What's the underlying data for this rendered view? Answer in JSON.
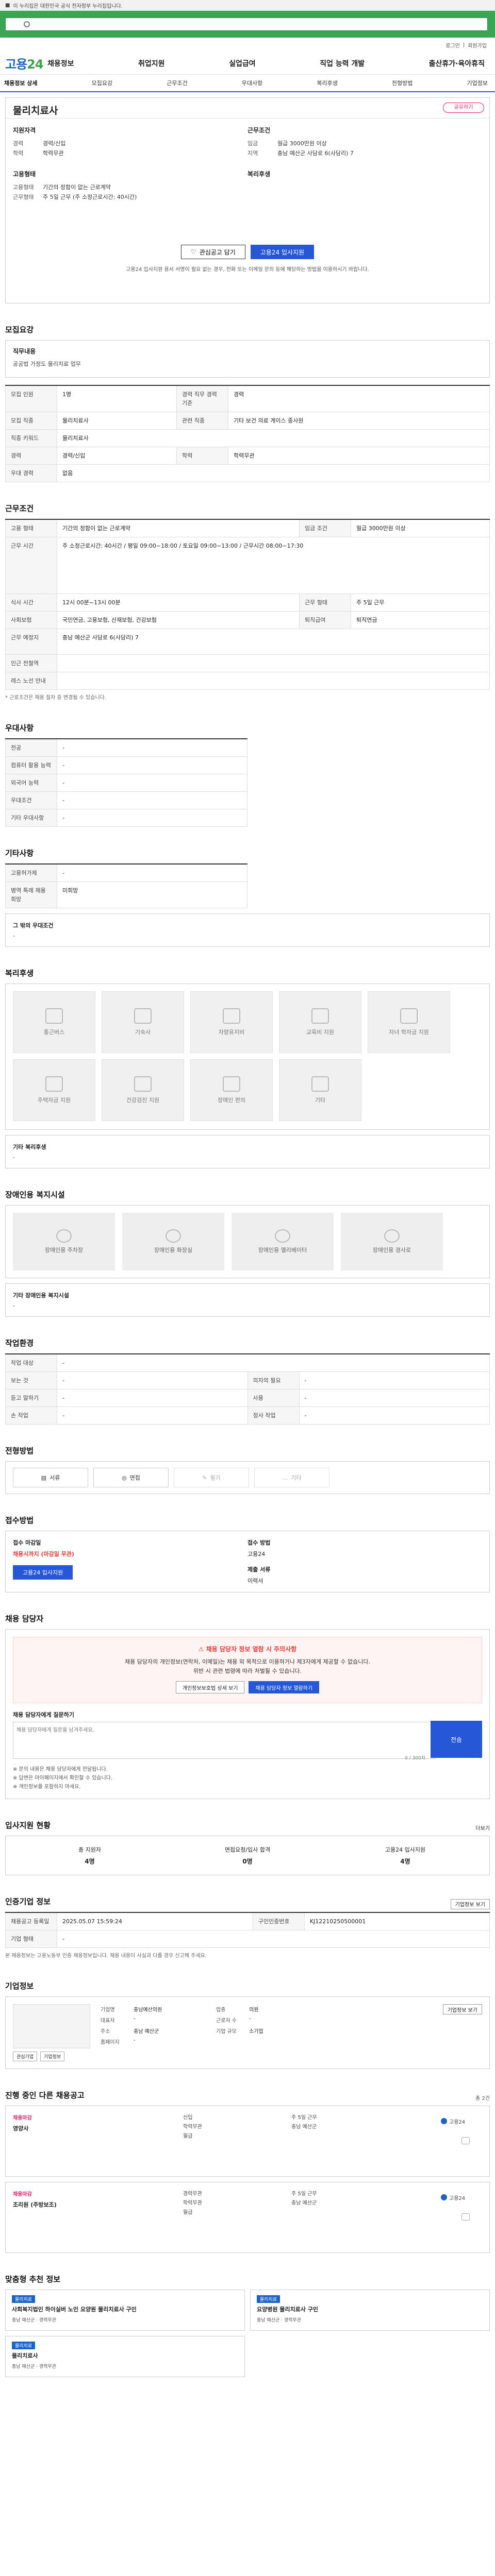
{
  "gov": {
    "text": "이 누리집은 대한민국 공식 전자정부 누리집입니다."
  },
  "search": {
    "placeholder": ""
  },
  "loginbar": {
    "login": "로그인",
    "join": "회원가입"
  },
  "gnb": {
    "logo_a": "고용",
    "logo_b": "24",
    "menu": [
      "채용정보",
      "취업지원",
      "실업급여",
      "직업 능력 개발",
      "출산휴가·육아휴직"
    ]
  },
  "snb": {
    "items": [
      "채용정보 상세",
      "모집요강",
      "근무조건",
      "우대사항",
      "복리후생",
      "전형방법",
      "기업정보"
    ]
  },
  "head": {
    "title": "물리치료사",
    "share": "공유하기",
    "col1": {
      "g1": {
        "title": "지원자격",
        "rows": [
          {
            "k": "경력",
            "v": "경력/신입"
          },
          {
            "k": "학력",
            "v": "학력무관"
          }
        ]
      },
      "g2": {
        "title": "고용형태",
        "rows": [
          {
            "k": "고용형태",
            "v": "기간의 정함이 없는 근로계약"
          },
          {
            "k": "근무형태",
            "v": "주 5일 근무 (주 소정근로시간: 40시간)"
          }
        ]
      }
    },
    "col2": {
      "g1": {
        "title": "근무조건",
        "rows": [
          {
            "k": "임금",
            "v": "월급 3000만원 이상"
          },
          {
            "k": "지역",
            "v": "충남 예산군 사담로 6(사담리) 7"
          }
        ]
      },
      "g2": {
        "title": "복리후생",
        "rows": []
      }
    },
    "btn_save": "관심공고 담기",
    "btn_apply": "고용24 입사지원",
    "note": "고용24 입사지원 용서 서명이 필요 없는 경우, 전화 또는 이메일 문의 등에 해당하는 방법을 이용하시기 바랍니다."
  },
  "recruit": {
    "h": "모집요강",
    "box_title": "직무내용",
    "box_text": "공공법 가정도 물리치료 업무"
  },
  "req": {
    "rows": [
      {
        "k": "모집 인원",
        "v": "1명",
        "k2": "경력 직무 경력 기준",
        "v2": "경력"
      },
      {
        "k": "모집 직종",
        "v": "물리치료사",
        "k2": "관련 직종",
        "v2": "기타 보건 의료 게이스 종사원"
      },
      {
        "k": "직종 키워드",
        "v": "물리치료사",
        "k2": "",
        "v2": ""
      },
      {
        "k": "경력",
        "v": "경력/신입",
        "k2": "학력",
        "v2": "학력무관"
      },
      {
        "k": "우대 경력",
        "v": "없음",
        "k2": "",
        "v2": ""
      }
    ]
  },
  "cond": {
    "h": "근무조건",
    "rows": [
      {
        "k": "고용 형태",
        "v": "기간의 정함이 없는 근로계약",
        "k2": "임금 조건",
        "v2": "월급 3000만원 이상"
      },
      {
        "k": "근무 시간",
        "v": "주 소정근로시간: 40시간 / 평일 09:00~18:00 / 토요일 09:00~13:00 / 근무시간 08:00~17:30",
        "k2": "",
        "v2": ""
      },
      {
        "k": "식사 시간",
        "v": "12시 00분~13시 00분",
        "k2": "근무 형태",
        "v2": "주 5일 근무"
      },
      {
        "k": "사회보험",
        "v": "국민연금, 고용보험, 산재보험, 건강보험",
        "k2": "퇴직급여",
        "v2": "퇴직연금"
      },
      {
        "k": "근무 예정지",
        "v": "충남 예산군 사담로 6(사담리) 7",
        "k2": "",
        "v2": ""
      },
      {
        "k": "인근 전철역",
        "v": "",
        "k2": "",
        "v2": ""
      },
      {
        "k": "레스 노선 안내",
        "v": "",
        "k2": "",
        "v2": ""
      }
    ],
    "note": "* 근로조건은 채용 절차 중 변경될 수 있습니다."
  },
  "pref": {
    "h": "우대사항",
    "rows": [
      {
        "k": "전공",
        "v": "-"
      },
      {
        "k": "컴퓨터 활용 능력",
        "v": "-"
      },
      {
        "k": "외국어 능력",
        "v": "-"
      },
      {
        "k": "우대조건",
        "v": "-"
      },
      {
        "k": "기타 우대사항",
        "v": "-"
      }
    ]
  },
  "etc": {
    "h": "기타사항",
    "rows": [
      {
        "k": "고용허가제",
        "v": "-"
      },
      {
        "k": "병역 특례 채용 희망",
        "v": "미희망"
      }
    ],
    "sub_lab": "그 밖의 우대조건",
    "sub_v": "-"
  },
  "welfare": {
    "h": "복리후생",
    "row1": [
      "통근버스",
      "기숙사",
      "차량유지비",
      "교육비 지원",
      "자녀 학자금 지원"
    ],
    "row2": [
      "주택자금 지원",
      "건강검진 지원",
      "장애인 편의",
      "기타"
    ],
    "sub_lab": "기타 복리후생",
    "sub_v": "-"
  },
  "disab": {
    "h": "장애인용 복지시설",
    "items": [
      "장애인용 주차장",
      "장애인용 화장실",
      "장애인용 엘리베이터",
      "장애인용 경사로"
    ],
    "sub_lab": "기타 장애인용 복지시설",
    "sub_v": "-"
  },
  "work": {
    "h": "작업환경",
    "rows": [
      {
        "k": "작업 대상",
        "v": "-",
        "k2": "",
        "v2": ""
      },
      {
        "k": "보는 것",
        "v": "-",
        "k2": "의자의 필요",
        "v2": "-"
      },
      {
        "k": "듣고 말하기",
        "v": "-",
        "k2": "사용",
        "v2": "-"
      },
      {
        "k": "손 작업",
        "v": "-",
        "k2": "정사 작업",
        "v2": "-"
      }
    ]
  },
  "method": {
    "h": "전형방법",
    "items": [
      {
        "l": "서류",
        "on": true
      },
      {
        "l": "면접",
        "on": true
      },
      {
        "l": "필기",
        "on": false
      },
      {
        "l": "기타",
        "on": false
      }
    ]
  },
  "apply": {
    "h": "접수방법",
    "c1": {
      "k": "접수 마감일",
      "v": "채용시까지 (마감일 무관)",
      "btn": "고용24 입사지원"
    },
    "c2": {
      "k": "접수 방법",
      "v": "고용24",
      "k2": "제출 서류",
      "v2": "이력서"
    }
  },
  "mgr": {
    "h": "채용 담당자",
    "warn": "채용 담당자 정보 열람 시 주의사항",
    "p1": "채용 담당자의 개인정보(연락처, 이메일)는 채용 외 목적으로 이용하거나 제3자에게 제공할 수 없습니다.",
    "p2": "위반 시 관련 법령에 따라 처벌될 수 있습니다.",
    "b1": "개인정보보호법 상세 보기",
    "b2": "채용 담당자 정보 열람하기",
    "qa_lab": "채용 담당자에게 질문하기",
    "qa_ph": "채용 담당자에게 질문을 남겨주세요.",
    "qa_btn": "전송",
    "qa_cnt": "0 / 300자",
    "n1": "※ 문의 내용은 채용 담당자에게 전달됩니다.",
    "n2": "※ 답변은 마이페이지에서 확인할 수 있습니다.",
    "n3": "※ 개인정보를 포함하지 마세요."
  },
  "stats": {
    "h": "입사지원 현황",
    "more": "더보기",
    "items": [
      {
        "k": "총 지원자",
        "v": "4명"
      },
      {
        "k": "면접요청/입사 합격",
        "v": "0명"
      },
      {
        "k": "고용24 입사지원",
        "v": "4명"
      }
    ],
    "note": ""
  },
  "info": {
    "h": "인증기업 정보",
    "btn": "기업정보 보기",
    "rows": [
      {
        "k": "채용공고 등록일",
        "v": "2025.05.07 15:59:24",
        "k2": "구인인증번호",
        "v2": "KJ12210250500001"
      },
      {
        "k": "기업 형태",
        "v": "-",
        "k2": "",
        "v2": ""
      }
    ],
    "note": "본 채용정보는 고용노동부 인증 채용정보입니다. 채용 내용이 사실과 다를 경우 신고해 주세요."
  },
  "corp": {
    "h": "기업정보",
    "img_b1": "관심기업",
    "img_b2": "기업정보",
    "rows": [
      {
        "k": "기업명",
        "v": "충남예산의원",
        "k2": "업종",
        "v2": "의원"
      },
      {
        "k": "대표자",
        "v": "-",
        "k2": "근로자 수",
        "v2": "-"
      },
      {
        "k": "주소",
        "v": "충남 예산군",
        "k2": "기업 규모",
        "v2": "소기업"
      },
      {
        "k": "홈페이지",
        "v": "-",
        "k2": "",
        "v2": ""
      }
    ],
    "btn": "기업정보 보기"
  },
  "jobs": {
    "h": "진행 중인 다른 채용공고",
    "sub": "총 2건",
    "items": [
      {
        "tag": "채용마감",
        "ttl": "영양사",
        "mid": [
          "신입",
          "학력무관",
          "월급"
        ],
        "right": [
          "주 5일 근무",
          "충남 예산군"
        ],
        "logo": "고용24"
      },
      {
        "tag": "채용마감",
        "ttl": "조리원 (주방보조)",
        "mid": [
          "경력무관",
          "학력무관",
          "월급"
        ],
        "right": [
          "주 5일 근무",
          "충남 예산군"
        ],
        "logo": "고용24"
      }
    ]
  },
  "rec": {
    "h": "맞춤형 추천 정보",
    "items": [
      {
        "tag": "물리치료",
        "t": "사회복지법인 하이실버 노인 요양원 물리치료사 구인",
        "m": "충남 예산군 · 경력무관"
      },
      {
        "tag": "물리치료",
        "t": "요양병원 물리치료사 구인",
        "m": "충남 예산군 · 경력무관"
      },
      {
        "tag": "물리치료",
        "t": "물리치료사",
        "m": "충남 예산군 · 경력무관"
      }
    ]
  }
}
